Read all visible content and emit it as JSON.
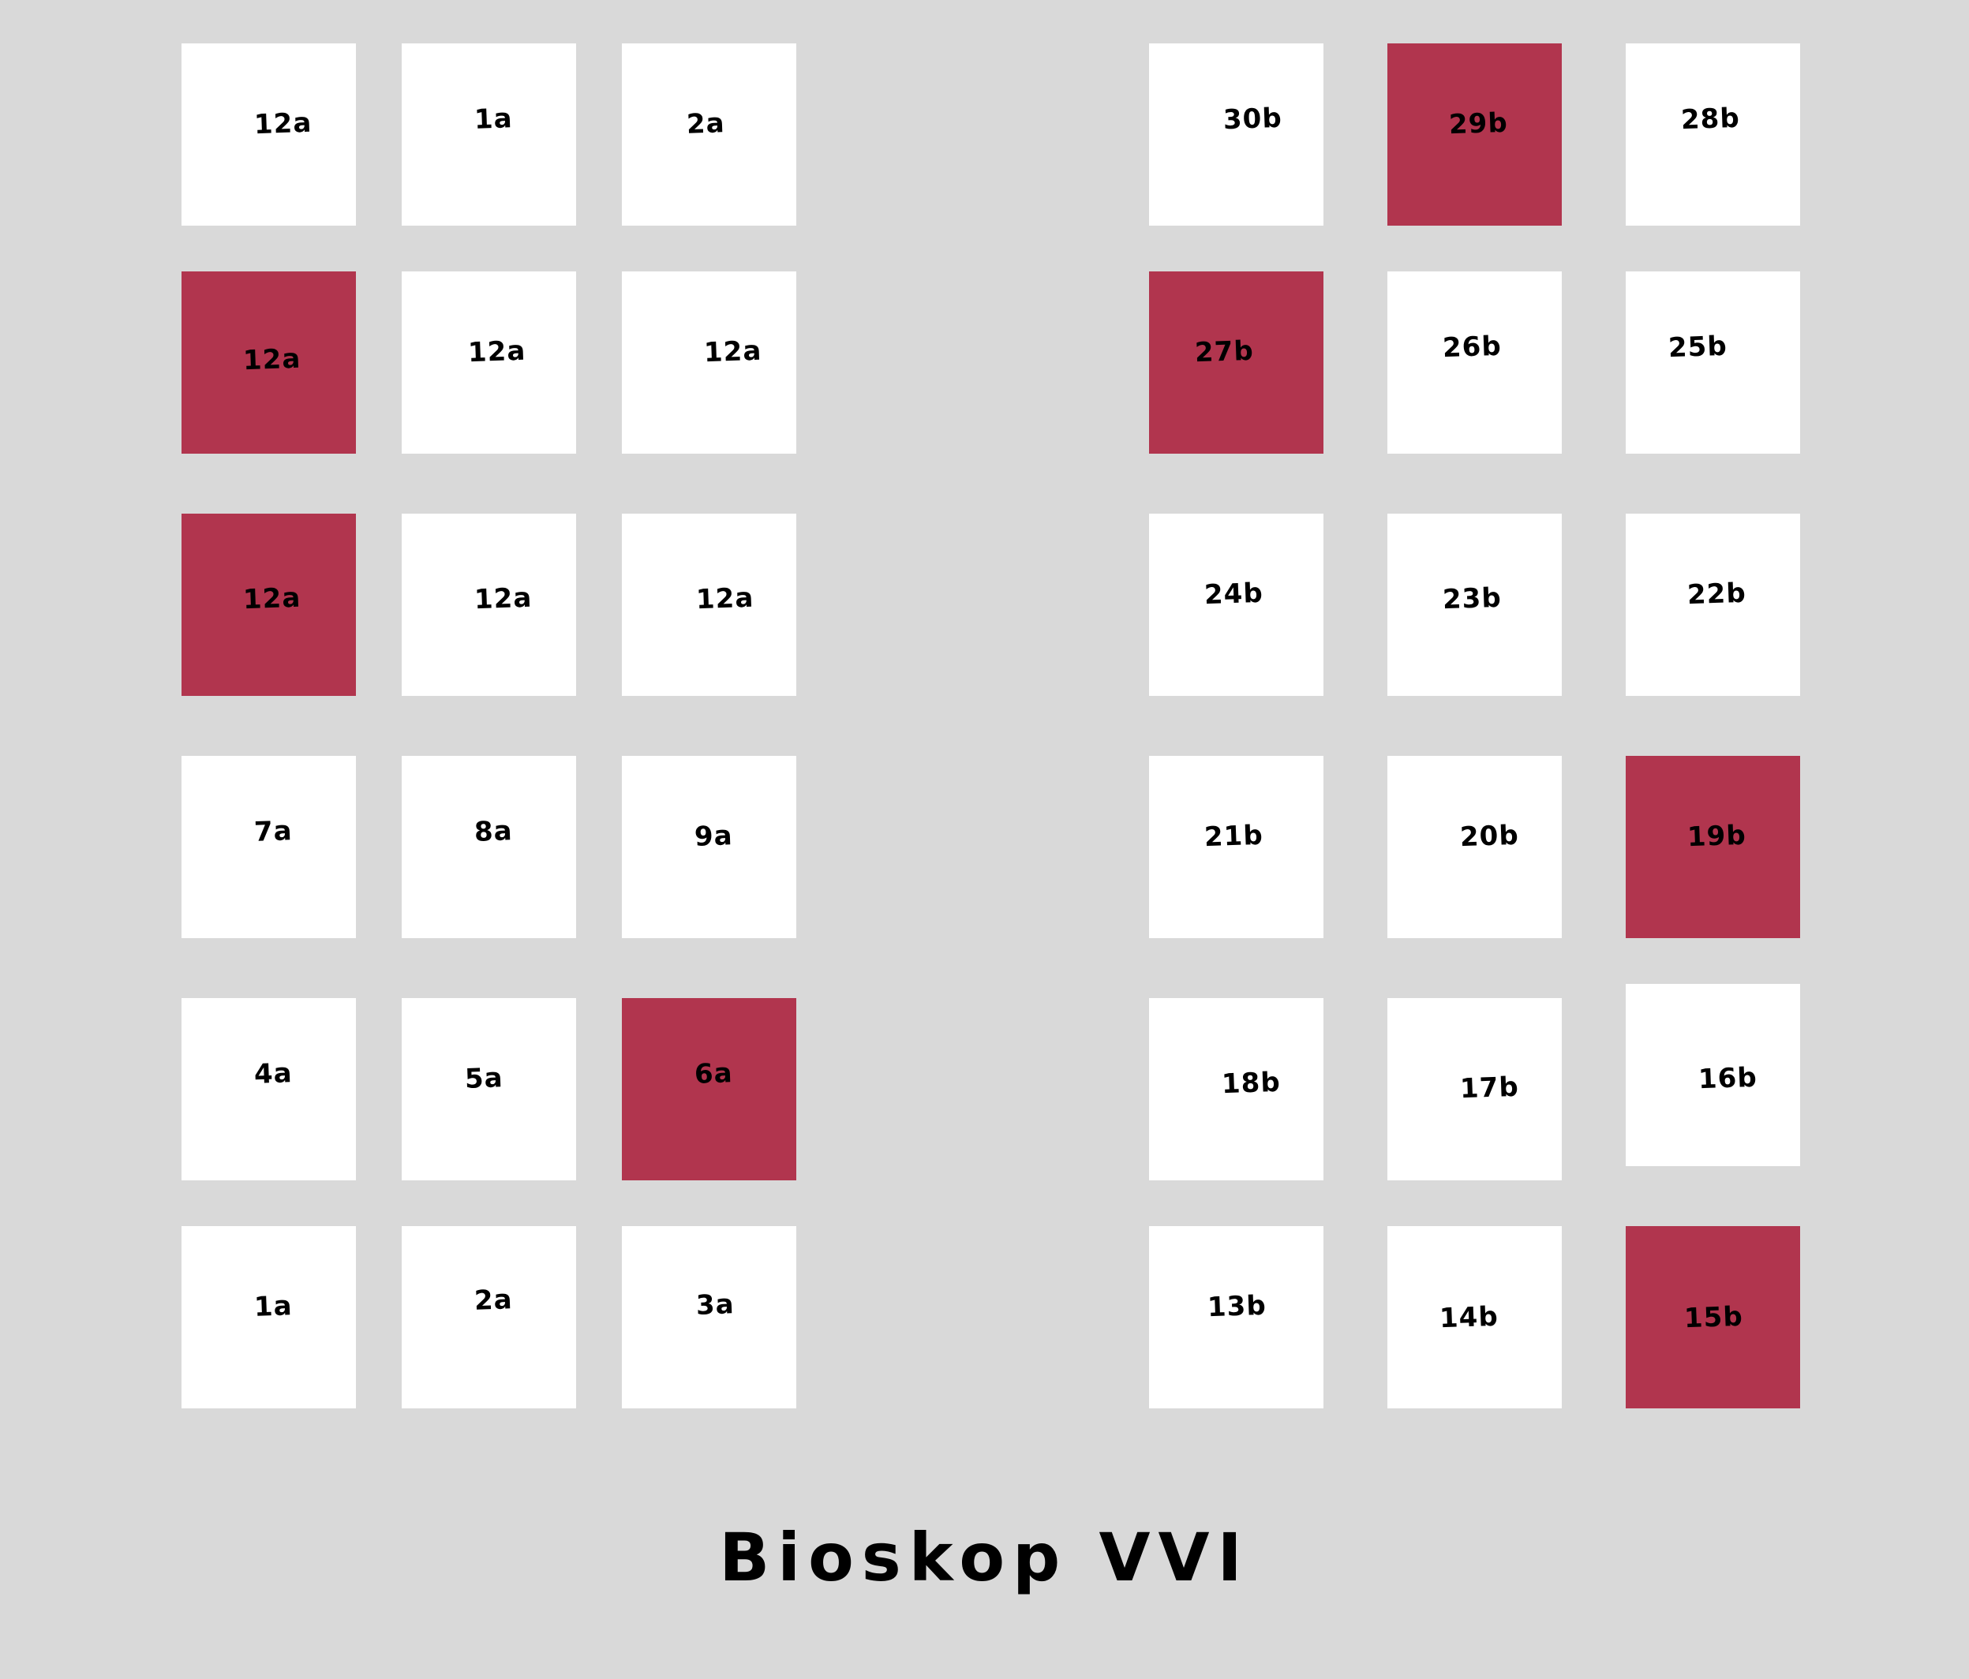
{
  "colors": {
    "background": "#d9d9d9",
    "seat_available": "#ffffff",
    "seat_taken": "#b1354e",
    "label": "#000000"
  },
  "title": "Bioskop VVI",
  "seats_left": [
    [
      {
        "label": "12a",
        "taken": false
      },
      {
        "label": "1a",
        "taken": false
      },
      {
        "label": "2a",
        "taken": false
      }
    ],
    [
      {
        "label": "12a",
        "taken": true
      },
      {
        "label": "12a",
        "taken": false
      },
      {
        "label": "12a",
        "taken": false
      }
    ],
    [
      {
        "label": "12a",
        "taken": true
      },
      {
        "label": "12a",
        "taken": false
      },
      {
        "label": "12a",
        "taken": false
      }
    ],
    [
      {
        "label": "7a",
        "taken": false
      },
      {
        "label": "8a",
        "taken": false
      },
      {
        "label": "9a",
        "taken": false
      }
    ],
    [
      {
        "label": "4a",
        "taken": false
      },
      {
        "label": "5a",
        "taken": false
      },
      {
        "label": "6a",
        "taken": true
      }
    ],
    [
      {
        "label": "1a",
        "taken": false
      },
      {
        "label": "2a",
        "taken": false
      },
      {
        "label": "3a",
        "taken": false
      }
    ]
  ],
  "seats_right": [
    [
      {
        "label": "30b",
        "taken": false
      },
      {
        "label": "29b",
        "taken": true
      },
      {
        "label": "28b",
        "taken": false
      }
    ],
    [
      {
        "label": "27b",
        "taken": true
      },
      {
        "label": "26b",
        "taken": false
      },
      {
        "label": "25b",
        "taken": false
      }
    ],
    [
      {
        "label": "24b",
        "taken": false
      },
      {
        "label": "23b",
        "taken": false
      },
      {
        "label": "22b",
        "taken": false
      }
    ],
    [
      {
        "label": "21b",
        "taken": false
      },
      {
        "label": "20b",
        "taken": false
      },
      {
        "label": "19b",
        "taken": true
      }
    ],
    [
      {
        "label": "18b",
        "taken": false
      },
      {
        "label": "17b",
        "taken": false
      },
      {
        "label": "16b",
        "taken": false
      }
    ],
    [
      {
        "label": "13b",
        "taken": false
      },
      {
        "label": "14b",
        "taken": false
      },
      {
        "label": "15b",
        "taken": true
      }
    ]
  ]
}
